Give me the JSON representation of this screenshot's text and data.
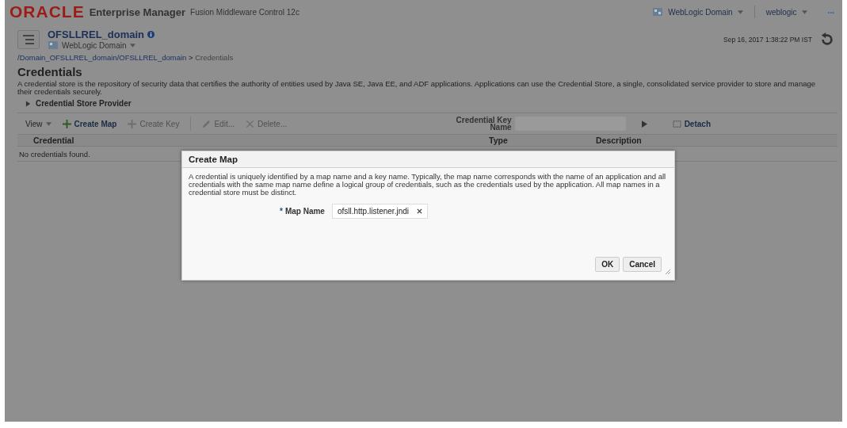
{
  "header": {
    "logo": "ORACLE",
    "product": "Enterprise Manager",
    "subtitle": "Fusion Middleware Control 12c",
    "domain_menu": "WebLogic Domain",
    "user_menu": "weblogic",
    "more": "•••"
  },
  "target": {
    "name": "OFSLLREL_domain",
    "type_menu": "WebLogic Domain",
    "timestamp": "Sep 16, 2017 1:38:22 PM IST"
  },
  "breadcrumb": {
    "link": "/Domain_OFSLLREL_domain/OFSLLREL_domain",
    "separator": ">",
    "current": "Credentials"
  },
  "page": {
    "title": "Credentials",
    "description": "A credential store is the repository of security data that certifies the authority of entities used by Java SE, Java EE, and ADF applications. Applications can use the Credential Store, a single, consolidated service provider to store and manage their credentials securely.",
    "section": {
      "label": "Credential Store Provider",
      "expanded": false
    }
  },
  "toolbar": {
    "view": "View",
    "buttons": [
      {
        "label": "Create Map",
        "kind": "plus",
        "disabled": false
      },
      {
        "label": "Create Key",
        "kind": "plus",
        "disabled": true
      },
      {
        "label": "Edit...",
        "kind": "pencil",
        "disabled": true
      },
      {
        "label": "Delete...",
        "kind": "cross",
        "disabled": true
      }
    ],
    "search_label": "Credential Key Name",
    "detach": "Detach"
  },
  "table": {
    "columns": [
      "Credential",
      "Type",
      "Description"
    ],
    "empty_text": "No credentials found."
  },
  "dialog": {
    "title": "Create Map",
    "text": "A credential is uniquely identified by a map name and a key name. Typically, the map name corresponds with the name of an application and all credentials with the same map name define a logical group of credentials, such as the credentials used by the application. All map names in a credential store must be distinct.",
    "required_mark": "*",
    "field_label": "Map Name",
    "value": "ofsll.http.listener.jndi",
    "buttons": [
      "OK",
      "Cancel"
    ]
  }
}
